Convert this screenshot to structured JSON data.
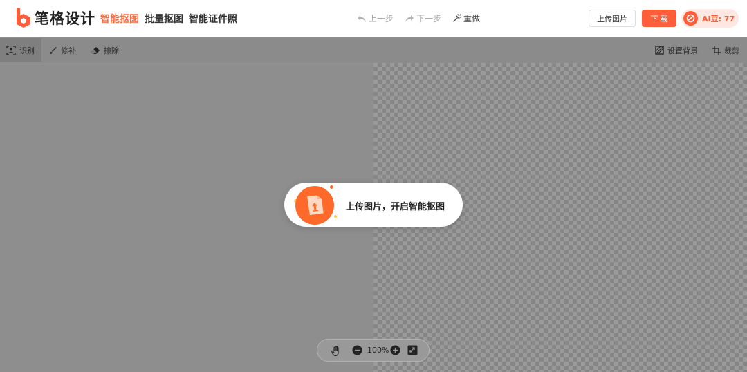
{
  "header": {
    "brand_text": "笔格设计",
    "nav": [
      {
        "label": "智能抠图",
        "active": true
      },
      {
        "label": "批量抠图",
        "active": false
      },
      {
        "label": "智能证件照",
        "active": false
      }
    ],
    "history": {
      "undo_label": "上一步",
      "redo_label": "下一步",
      "reset_label": "重做"
    },
    "upload_label": "上传图片",
    "download_label": "下 载",
    "ai_label": "AI豆: 77",
    "accent_color": "#ff5e3a"
  },
  "toolbar": {
    "recognize_label": "识别",
    "repair_label": "修补",
    "erase_label": "擦除",
    "background_label": "设置背景",
    "crop_label": "裁剪"
  },
  "canvas": {
    "prompt_text": "上传图片，开启智能抠图"
  },
  "zoom": {
    "value": "100%"
  }
}
